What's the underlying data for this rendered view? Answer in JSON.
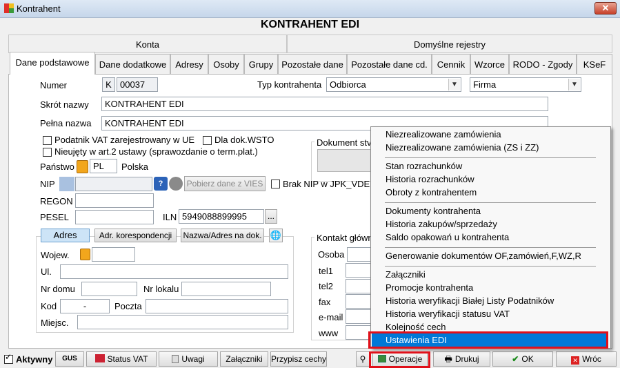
{
  "window": {
    "title": "Kontrahent"
  },
  "header": {
    "title": "KONTRAHENT EDI"
  },
  "group_tabs": [
    "Konta",
    "Domyślne rejestry"
  ],
  "tabs": [
    "Dane podstawowe",
    "Dane dodatkowe",
    "Adresy",
    "Osoby",
    "Grupy",
    "Pozostałe dane",
    "Pozostałe dane cd.",
    "Cennik",
    "Wzorce",
    "RODO - Zgody",
    "KSeF"
  ],
  "form": {
    "numer_label": "Numer",
    "numer_prefix": "K",
    "numer_value": "00037",
    "typ_label": "Typ kontrahenta",
    "typ_value": "Odbiorca",
    "forma_value": "Firma",
    "skrot_label": "Skrót nazwy",
    "skrot_value": "KONTRAHENT EDI",
    "pelna_label": "Pełna nazwa",
    "pelna_value": "KONTRAHENT EDI",
    "vat_ue_label": "Podatnik VAT zarejestrowany  w UE",
    "wsto_label": "Dla dok.WSTO",
    "nieujety_label": "Nieujęty w art.2 ustawy (sprawozdanie o term.plat.)",
    "dokument_label": "Dokument stv",
    "panstwo_label": "Państwo",
    "panstwo_code": "PL",
    "panstwo_name": "Polska",
    "nip_label": "NIP",
    "vies_button": "Pobierz dane z VIES",
    "brak_nip_label": "Brak NIP w JPK_VDE",
    "regon_label": "REGON",
    "pesel_label": "PESEL",
    "iln_label": "ILN",
    "iln_value": "5949088899995",
    "ellipsis": "..."
  },
  "address": {
    "tab_adres": "Adres",
    "tab_kores": "Adr. korespondencji",
    "tab_nazwa": "Nazwa/Adres na dok.",
    "wojew_label": "Wojew.",
    "ul_label": "Ul.",
    "nr_domu_label": "Nr domu",
    "nr_lokalu_label": "Nr lokalu",
    "kod_label": "Kod",
    "kod_value": "-",
    "poczta_label": "Poczta",
    "miejsc_label": "Miejsc."
  },
  "contact": {
    "title": "Kontakt główn",
    "osoba": "Osoba",
    "tel1": "tel1",
    "tel2": "tel2",
    "fax": "fax",
    "email": "e-mail",
    "www": "www"
  },
  "menu": {
    "items": [
      "Niezrealizowane zamówienia",
      "Niezrealizowane zamówienia (ZS i ZZ)",
      "Stan rozrachunków",
      "Historia rozrachunków",
      "Obroty z kontrahentem",
      "Dokumenty kontrahenta",
      "Historia zakupów/sprzedaży",
      "Saldo opakowań u kontrahenta",
      "Generowanie dokumentów OF,zamówień,F,WZ,R",
      "Załączniki",
      "Promocje kontrahenta",
      "Historia weryfikacji Białej Listy Podatników",
      "Historia weryfikacji statusu VAT",
      "Kolejność cech",
      "Ustawienia EDI"
    ]
  },
  "bottom": {
    "aktywny": "Aktywny",
    "gus": "GUS",
    "status_vat": "Status VAT",
    "uwagi": "Uwagi",
    "zalaczniki": "Załączniki",
    "przypisz": "Przypisz cechy",
    "operacje": "Operacje",
    "drukuj": "Drukuj",
    "ok": "OK",
    "wroc": "Wróc"
  },
  "colors": {
    "highlight": "#0078d7",
    "annotation": "#e0101a"
  }
}
